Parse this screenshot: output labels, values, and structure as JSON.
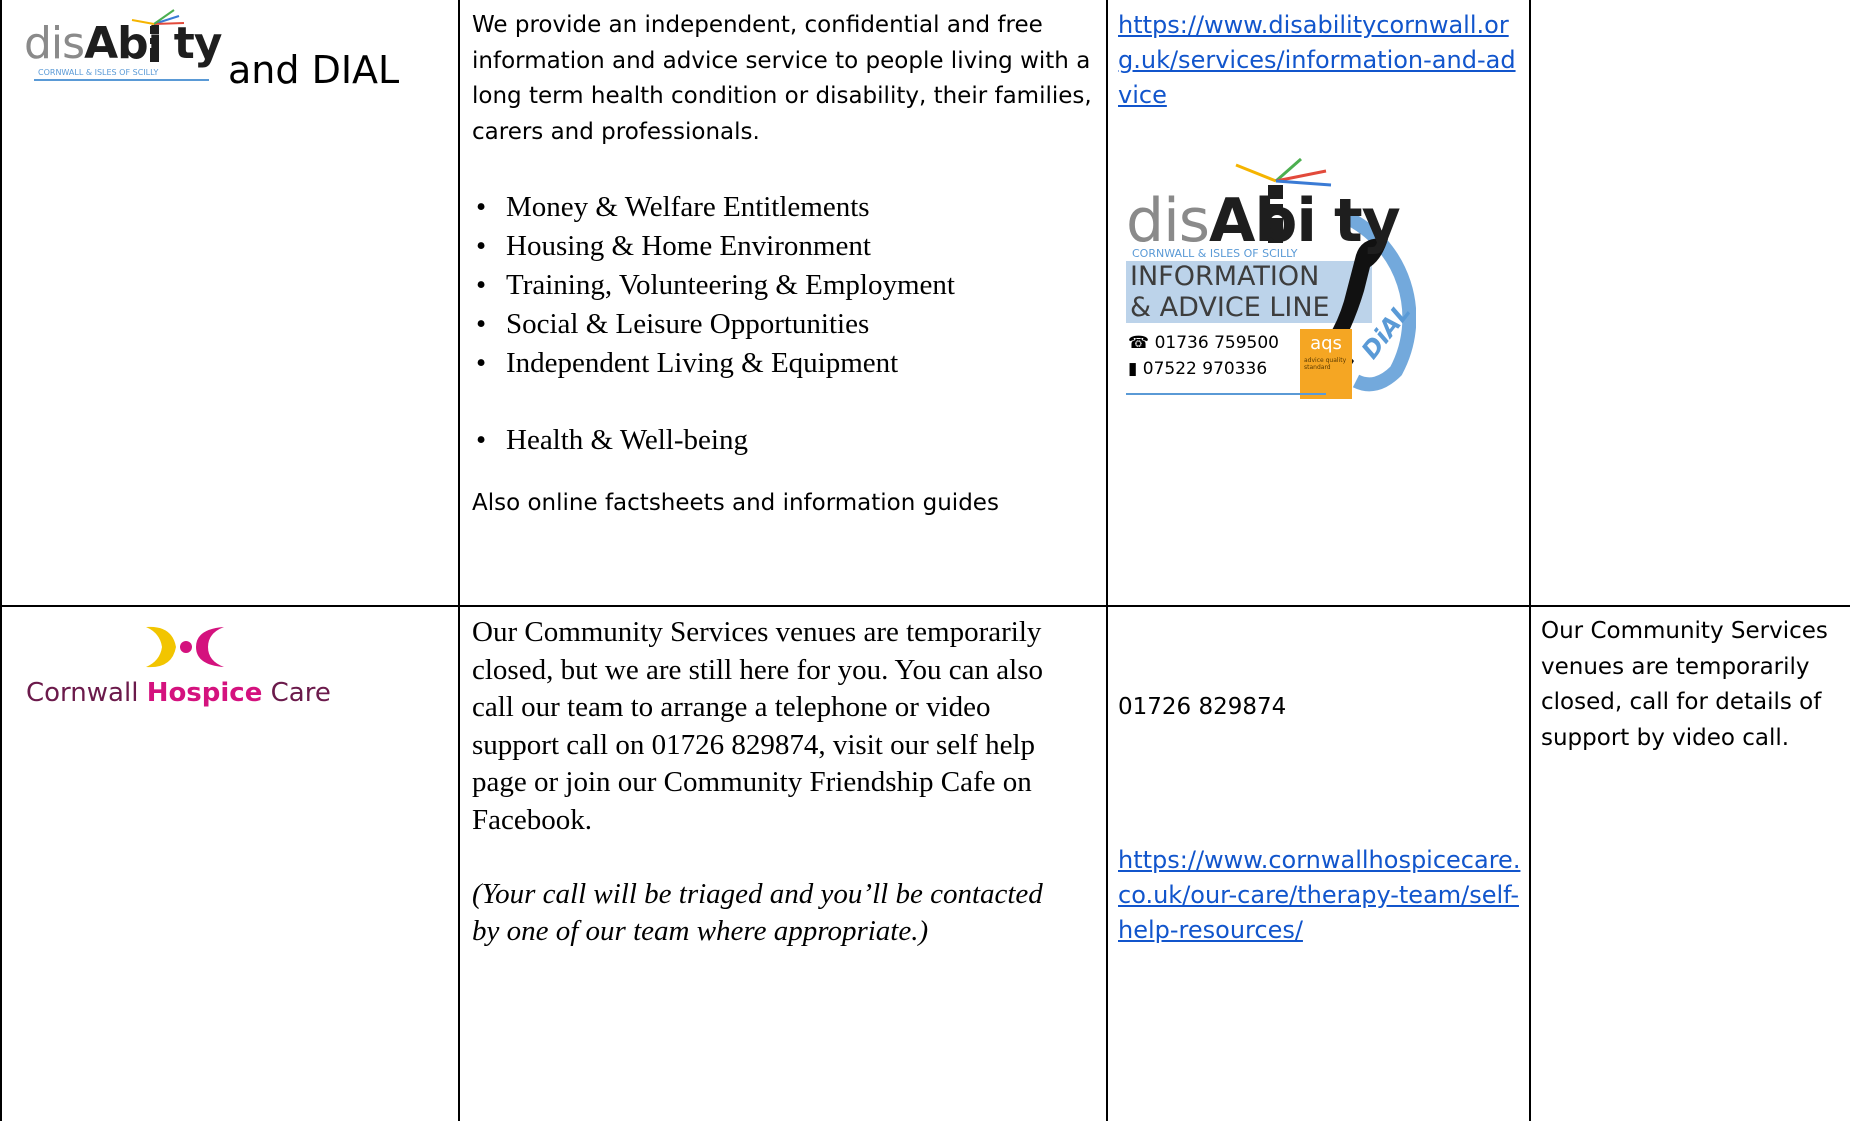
{
  "rows": [
    {
      "org": {
        "logo_word_dis": "dis",
        "logo_word_ability": "Abi",
        "logo_word_ty": "ty",
        "logo_subtitle": "CORNWALL & ISLES OF SCILLY",
        "suffix": "and DIAL"
      },
      "description": {
        "intro": "We provide an independent, confidential and free information and advice service to people living with a long term health condition or disability, their families, carers and professionals.",
        "services": [
          "Money & Welfare Entitlements",
          "Housing & Home Environment",
          "Training, Volunteering & Employment",
          "Social & Leisure Opportunities",
          "Independent Living & Equipment",
          "Health & Well-being"
        ],
        "footer": "Also online factsheets and information guides"
      },
      "contact": {
        "url": "https://www.disabilitycornwall.org.uk/services/information-and-advice",
        "dial_logo": {
          "word_dis": "dis",
          "word_ability": "Abi",
          "word_ty": "ty",
          "subtitle": "CORNWALL & ISLES OF SCILLY",
          "line1": "INFORMATION",
          "line2": "& ADVICE LINE",
          "phone1": "01736 759500",
          "phone2": "07522 970336",
          "badge": "aqs",
          "badge_small": "advice quality standard",
          "dial_word": "DiAL"
        }
      },
      "notes": ""
    },
    {
      "org": {
        "logo_name_part1": "Cornwall ",
        "logo_name_part2": "Hospice",
        "logo_name_part3": " Care"
      },
      "description": {
        "body": "Our Community Services venues are temporarily closed, but we are still here for you.  You can also call our team to arrange a telephone or video support call on 01726 829874, visit our self help page or join our Community Friendship Cafe on Facebook.",
        "note": "(Your call will be triaged and you’ll be contacted by one of our team where appropriate.)"
      },
      "contact": {
        "phone": "01726 829874",
        "url": "https://www.cornwallhospicecare.co.uk/our-care/therapy-team/self-help-resources/"
      },
      "notes": "Our Community Services venues are temporarily closed, call for details of support by video call."
    }
  ],
  "colors": {
    "link": "#1155cc",
    "ability_dark": "#1e1e1e",
    "scilly_blue": "#5a9ad6",
    "hospice_yellow": "#f2c500",
    "hospice_pink": "#d4127e",
    "dial_blue_box": "#bcd3ea",
    "aqs_orange": "#f5a623"
  }
}
